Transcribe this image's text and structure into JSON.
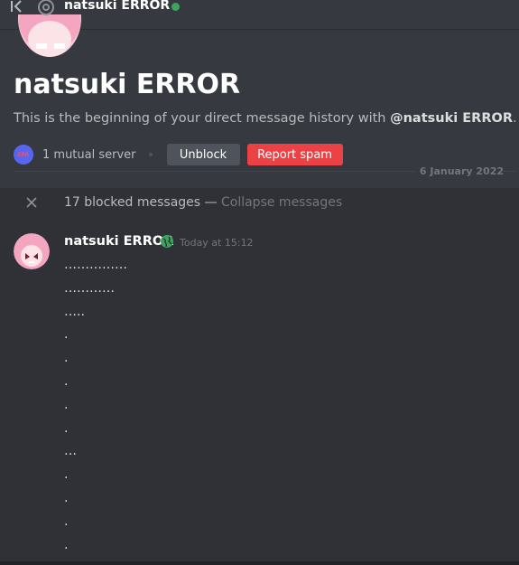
{
  "topbar": {
    "username": "natsuki ERROR",
    "status_color": "#3ba55d"
  },
  "header": {
    "display_name": "natsuki ERROR",
    "intro_prefix": "This is the beginning of your direct message history with ",
    "intro_handle": "@natsuki ERROR",
    "intro_suffix": ".",
    "mutual_servers": "1 mutual server",
    "unblock_label": "Unblock",
    "report_label": "Report spam"
  },
  "date_divider": "6 January 2022",
  "blocked": {
    "text": "17 blocked messages — ",
    "collapse_label": "Collapse messages"
  },
  "message": {
    "author": "natsuki ERROR",
    "timestamp": "Today at 15:12",
    "lines": [
      "……………",
      "…………",
      "…..",
      ".",
      ".",
      ".",
      ".",
      ".",
      "…",
      ".",
      ".",
      ".",
      "."
    ]
  },
  "colors": {
    "accent_red": "#ed4245",
    "accent_blurple": "#5865f2",
    "online_green": "#3ba55d"
  }
}
